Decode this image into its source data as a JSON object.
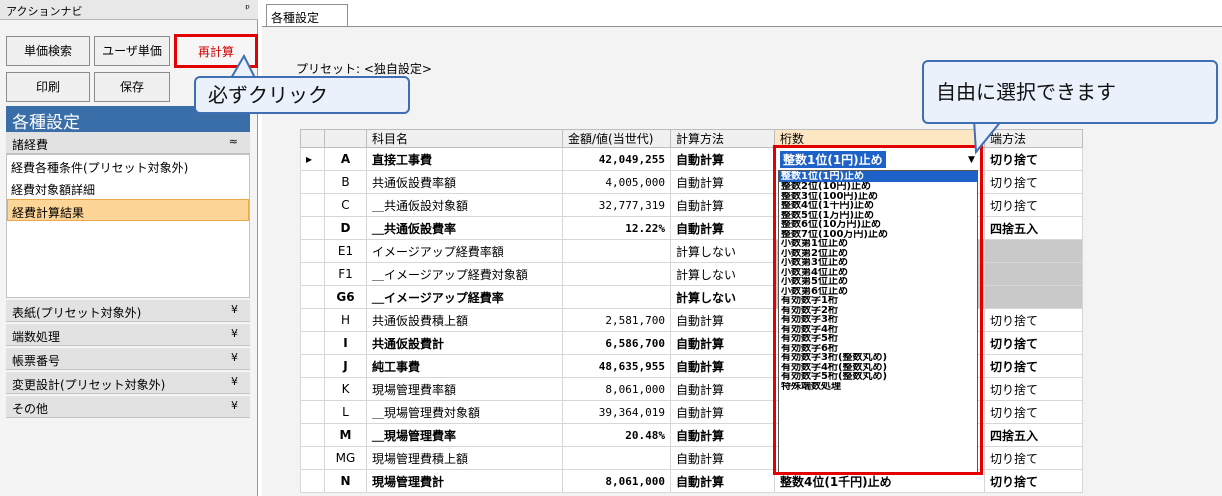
{
  "left_panel": {
    "title": "アクションナビ",
    "pin": "ᵖ",
    "buttons": {
      "search": "単価検索",
      "user_price": "ユーザ単価",
      "recalc": "再計算",
      "print": "印刷",
      "save": "保存"
    },
    "section_title": "各種設定",
    "groups": [
      {
        "label": "諸経費",
        "state": "expanded"
      },
      {
        "label": "表紙(プリセット対象外)",
        "state": "collapsed"
      },
      {
        "label": "端数処理",
        "state": "collapsed"
      },
      {
        "label": "帳票番号",
        "state": "collapsed"
      },
      {
        "label": "変更設計(プリセット対象外)",
        "state": "collapsed"
      },
      {
        "label": "その他",
        "state": "collapsed"
      }
    ],
    "group_items": [
      "経費各種条件(プリセット対象外)",
      "経費対象額詳細",
      "経費計算結果"
    ],
    "selected_item": "経費計算結果",
    "chevron_up": "≈",
    "chevron_down": "¥"
  },
  "tab": {
    "label": "各種設定"
  },
  "preset": "プリセット: <独自設定>",
  "grid": {
    "columns": [
      "科目名",
      "金額/値(当世代)",
      "計算方法",
      "桁数",
      "端方法"
    ],
    "rows": [
      {
        "id": "A",
        "name": "直接工事費",
        "value": "42,049,255",
        "method": "自動計算",
        "digits": "整数1位(1円)止め",
        "rounding": "切り捨て",
        "bold": true
      },
      {
        "id": "B",
        "name": "共通仮設費率額",
        "value": "4,005,000",
        "method": "自動計算",
        "digits": "",
        "rounding": "切り捨て",
        "bold": false
      },
      {
        "id": "C",
        "name": "＿共通仮設対象額",
        "value": "32,777,319",
        "method": "自動計算",
        "digits": "",
        "rounding": "切り捨て",
        "bold": false
      },
      {
        "id": "D",
        "name": "＿共通仮設費率",
        "value": "12.22%",
        "method": "自動計算",
        "digits": "",
        "rounding": "四捨五入",
        "bold": true
      },
      {
        "id": "E1",
        "name": "イメージアップ経費率額",
        "value": "",
        "method": "計算しない",
        "digits": "",
        "rounding": "",
        "bold": false
      },
      {
        "id": "F1",
        "name": "＿イメージアップ経費対象額",
        "value": "",
        "method": "計算しない",
        "digits": "",
        "rounding": "",
        "bold": false
      },
      {
        "id": "G6",
        "name": "＿イメージアップ経費率",
        "value": "",
        "method": "計算しない",
        "digits": "",
        "rounding": "",
        "bold": true
      },
      {
        "id": "H",
        "name": "共通仮設費積上額",
        "value": "2,581,700",
        "method": "自動計算",
        "digits": "",
        "rounding": "切り捨て",
        "bold": false
      },
      {
        "id": "I",
        "name": "共通仮設費計",
        "value": "6,586,700",
        "method": "自動計算",
        "digits": "",
        "rounding": "切り捨て",
        "bold": true
      },
      {
        "id": "J",
        "name": "純工事費",
        "value": "48,635,955",
        "method": "自動計算",
        "digits": "",
        "rounding": "切り捨て",
        "bold": true
      },
      {
        "id": "K",
        "name": "現場管理費率額",
        "value": "8,061,000",
        "method": "自動計算",
        "digits": "",
        "rounding": "切り捨て",
        "bold": false
      },
      {
        "id": "L",
        "name": "＿現場管理費対象額",
        "value": "39,364,019",
        "method": "自動計算",
        "digits": "",
        "rounding": "切り捨て",
        "bold": false
      },
      {
        "id": "M",
        "name": "＿現場管理費率",
        "value": "20.48%",
        "method": "自動計算",
        "digits": "",
        "rounding": "四捨五入",
        "bold": true
      },
      {
        "id": "MG",
        "name": "現場管理費積上額",
        "value": "",
        "method": "自動計算",
        "digits": "",
        "rounding": "切り捨て",
        "bold": false
      },
      {
        "id": "N",
        "name": "現場管理費計",
        "value": "8,061,000",
        "method": "自動計算",
        "digits": "整数4位(1千円)止め",
        "rounding": "切り捨て",
        "bold": true
      }
    ]
  },
  "dropdown": {
    "selected": "整数1位(1円)止め",
    "options": [
      "整数1位(1円)止め",
      "整数2位(10円)止め",
      "整数3位(100円)止め",
      "整数4位(1千円)止め",
      "整数5位(1万円)止め",
      "整数6位(10万円)止め",
      "整数7位(100万円)止め",
      "小数第1位止め",
      "小数第2位止め",
      "小数第3位止め",
      "小数第4位止め",
      "小数第5位止め",
      "小数第6位止め",
      "有効数字1桁",
      "有効数字2桁",
      "有効数字3桁",
      "有効数字4桁",
      "有効数字5桁",
      "有効数字6桁",
      "有効数字3桁(整数丸め)",
      "有効数字4桁(整数丸め)",
      "有効数字5桁(整数丸め)",
      "特殊端数処理"
    ]
  },
  "callouts": {
    "click": "必ずクリック",
    "free": "自由に選択できます"
  },
  "colors": {
    "highlight_red": "#e30000",
    "header_blue": "#3a6ea8",
    "select_blue": "#1e62c9",
    "selected_item": "#fdd596"
  }
}
